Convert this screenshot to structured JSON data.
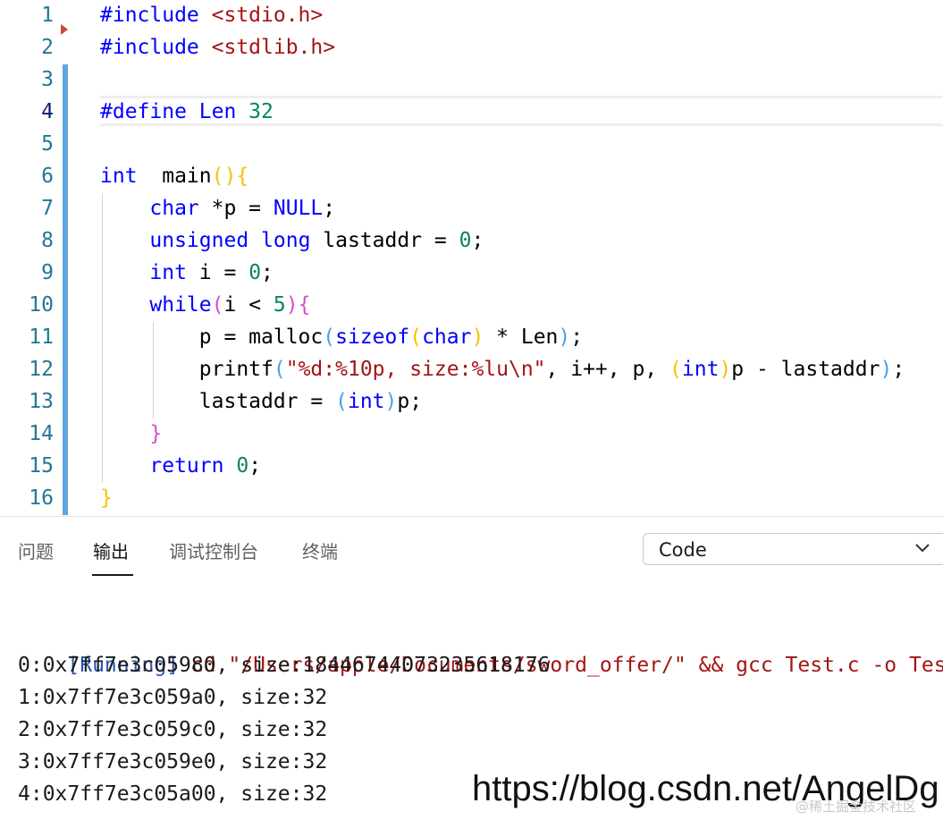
{
  "editor": {
    "line_numbers": [
      "1",
      "2",
      "3",
      "4",
      "5",
      "6",
      "7",
      "8",
      "9",
      "10",
      "11",
      "12",
      "13",
      "14",
      "15",
      "16"
    ],
    "lines": [
      [
        [
          "pp",
          "#include "
        ],
        [
          "str",
          "<stdio.h>"
        ]
      ],
      [
        [
          "pp",
          "#include "
        ],
        [
          "str",
          "<stdlib.h>"
        ]
      ],
      [],
      [
        [
          "pp",
          "#define "
        ],
        [
          "kw",
          "Len "
        ],
        [
          "num",
          "32"
        ]
      ],
      [],
      [
        [
          "kw",
          "int"
        ],
        [
          "",
          "  main"
        ],
        [
          "b1",
          "()"
        ],
        [
          "b1",
          "{"
        ]
      ],
      [
        [
          "",
          "    "
        ],
        [
          "kw",
          "char"
        ],
        [
          "",
          " *p = "
        ],
        [
          "kw",
          "NULL"
        ],
        [
          "",
          ";"
        ]
      ],
      [
        [
          "",
          "    "
        ],
        [
          "kw",
          "unsigned"
        ],
        [
          "",
          " "
        ],
        [
          "kw",
          "long"
        ],
        [
          "",
          " lastaddr = "
        ],
        [
          "num",
          "0"
        ],
        [
          "",
          ";"
        ]
      ],
      [
        [
          "",
          "    "
        ],
        [
          "kw",
          "int"
        ],
        [
          "",
          " i = "
        ],
        [
          "num",
          "0"
        ],
        [
          "",
          ";"
        ]
      ],
      [
        [
          "",
          "    "
        ],
        [
          "kw",
          "while"
        ],
        [
          "b2",
          "("
        ],
        [
          "",
          "i < "
        ],
        [
          "num",
          "5"
        ],
        [
          "b2",
          ")"
        ],
        [
          "b2",
          "{"
        ]
      ],
      [
        [
          "",
          "        p = malloc"
        ],
        [
          "b3",
          "("
        ],
        [
          "kw",
          "sizeof"
        ],
        [
          "b1",
          "("
        ],
        [
          "kw",
          "char"
        ],
        [
          "b1",
          ")"
        ],
        [
          "",
          " * Len"
        ],
        [
          "b3",
          ")"
        ],
        [
          "",
          ";"
        ]
      ],
      [
        [
          "",
          "        printf"
        ],
        [
          "b3",
          "("
        ],
        [
          "str",
          "\"%d:%10p, size:%lu\\n\""
        ],
        [
          "",
          ", i++, p, "
        ],
        [
          "b1",
          "("
        ],
        [
          "kw",
          "int"
        ],
        [
          "b1",
          ")"
        ],
        [
          "",
          "p - lastaddr"
        ],
        [
          "b3",
          ")"
        ],
        [
          "",
          ";"
        ]
      ],
      [
        [
          "",
          "        lastaddr = "
        ],
        [
          "b3",
          "("
        ],
        [
          "kw",
          "int"
        ],
        [
          "b3",
          ")"
        ],
        [
          "",
          "p;"
        ]
      ],
      [
        [
          "",
          "    "
        ],
        [
          "b2",
          "}"
        ]
      ],
      [
        [
          "",
          "    "
        ],
        [
          "kw",
          "return"
        ],
        [
          "",
          " "
        ],
        [
          "num",
          "0"
        ],
        [
          "",
          ";"
        ]
      ],
      [
        [
          "b1",
          "}"
        ]
      ]
    ]
  },
  "panel": {
    "tabs": [
      "问题",
      "输出",
      "调试控制台",
      "终端"
    ],
    "active_tab": "输出",
    "channel_select": "Code"
  },
  "output": {
    "run_tag": "[Running]",
    "run_cmd": " cd \"/Users/apple/Documents/sword_offer/\" && gcc Test.c -o Test",
    "lines": [
      "0:0x7ff7e3c05980, size:18446744073235618176",
      "1:0x7ff7e3c059a0, size:32",
      "2:0x7ff7e3c059c0, size:32",
      "3:0x7ff7e3c059e0, size:32",
      "4:0x7ff7e3c05a00, size:32"
    ]
  },
  "watermark": {
    "url": "https://blog.csdn.net/AngelDg",
    "sub": "@稀土掘金技术社区"
  },
  "colors": {
    "keyword": "#0000ff",
    "string": "#a31515",
    "number": "#098658",
    "line_number": "#237893",
    "change_bar": "#5ea6dd"
  }
}
